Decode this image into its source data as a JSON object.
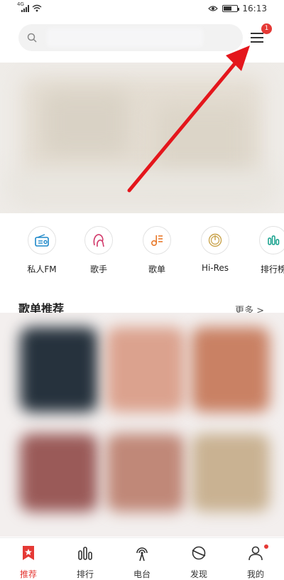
{
  "status_bar": {
    "network": "4G",
    "time": "16:13"
  },
  "search": {
    "placeholder": ""
  },
  "header": {
    "menu_badge": "1"
  },
  "quick_entries": [
    {
      "label": "私人FM",
      "icon": "radio-icon"
    },
    {
      "label": "歌手",
      "icon": "singer-icon"
    },
    {
      "label": "歌单",
      "icon": "playlist-icon"
    },
    {
      "label": "Hi-Res",
      "icon": "hires-icon"
    },
    {
      "label": "排行榜",
      "icon": "chart-icon"
    }
  ],
  "section": {
    "title": "歌单推荐",
    "more": "更多 >"
  },
  "bottom_nav": [
    {
      "label": "推荐",
      "icon": "star-bookmark-icon",
      "active": true
    },
    {
      "label": "排行",
      "icon": "bars-icon",
      "active": false
    },
    {
      "label": "电台",
      "icon": "antenna-icon",
      "active": false
    },
    {
      "label": "发现",
      "icon": "discover-icon",
      "active": false
    },
    {
      "label": "我的",
      "icon": "user-icon",
      "active": false
    }
  ],
  "colors": {
    "accent": "#e53935",
    "icon_tint": "#e87a5c"
  }
}
